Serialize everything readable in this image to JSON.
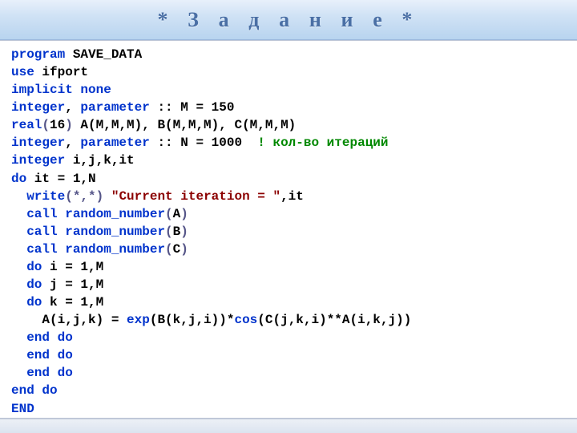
{
  "header": {
    "title": "* З а д а н и е *"
  },
  "code": {
    "l1_kw": "program",
    "l1_rest": " SAVE_DATA",
    "l2_kw": "use",
    "l2_rest": " ifport",
    "l3_kw": "implicit none",
    "l4_kw1": "integer",
    "l4_c": ", ",
    "l4_kw2": "parameter",
    "l4_rest": " :: M = 150",
    "l5_kw": "real",
    "l5_p1": "(",
    "l5_n": "16",
    "l5_p2": ")",
    "l5_rest": " A(M,M,M), B(M,M,M), C(M,M,M)",
    "l6_kw1": "integer",
    "l6_c": ", ",
    "l6_kw2": "parameter",
    "l6_rest": " :: N = 1000  ",
    "l6_cm": "! кол-во итераций",
    "l7_kw": "integer",
    "l7_rest": " i,j,k,it",
    "l8_kw": "do",
    "l8_rest": " it = 1,N",
    "l9_ind": "  ",
    "l9_kw": "write",
    "l9_p1": "(*,*)",
    "l9_sp": " ",
    "l9_str": "\"Current iteration = \"",
    "l9_rest": ",it",
    "l10_ind": "  ",
    "l10_kw": "call",
    "l10_sp": " ",
    "l10_fn": "random_number",
    "l10_p": "(",
    "l10_n": "A",
    "l10_p2": ")",
    "l11_ind": "  ",
    "l11_kw": "call",
    "l11_sp": " ",
    "l11_fn": "random_number",
    "l11_p": "(",
    "l11_n": "B",
    "l11_p2": ")",
    "l12_ind": "  ",
    "l12_kw": "call",
    "l12_sp": " ",
    "l12_fn": "random_number",
    "l12_p": "(",
    "l12_n": "C",
    "l12_p2": ")",
    "l13_ind": "  ",
    "l13_kw": "do",
    "l13_rest": " i = 1,M",
    "l14_ind": "  ",
    "l14_kw": "do",
    "l14_rest": " j = 1,M",
    "l15_ind": "  ",
    "l15_kw": "do",
    "l15_rest": " k = 1,M",
    "l16_ind": "    ",
    "l16_a": "A(i,j,k) = ",
    "l16_fn1": "exp",
    "l16_b": "(B(k,j,i))*",
    "l16_fn2": "cos",
    "l16_c": "(C(j,k,i)**A(i,k,j))",
    "l17_ind": "  ",
    "l17_kw": "end do",
    "l18_ind": "  ",
    "l18_kw": "end do",
    "l19_ind": "  ",
    "l19_kw": "end do",
    "l20_kw": "end do",
    "l21_kw": "END"
  }
}
